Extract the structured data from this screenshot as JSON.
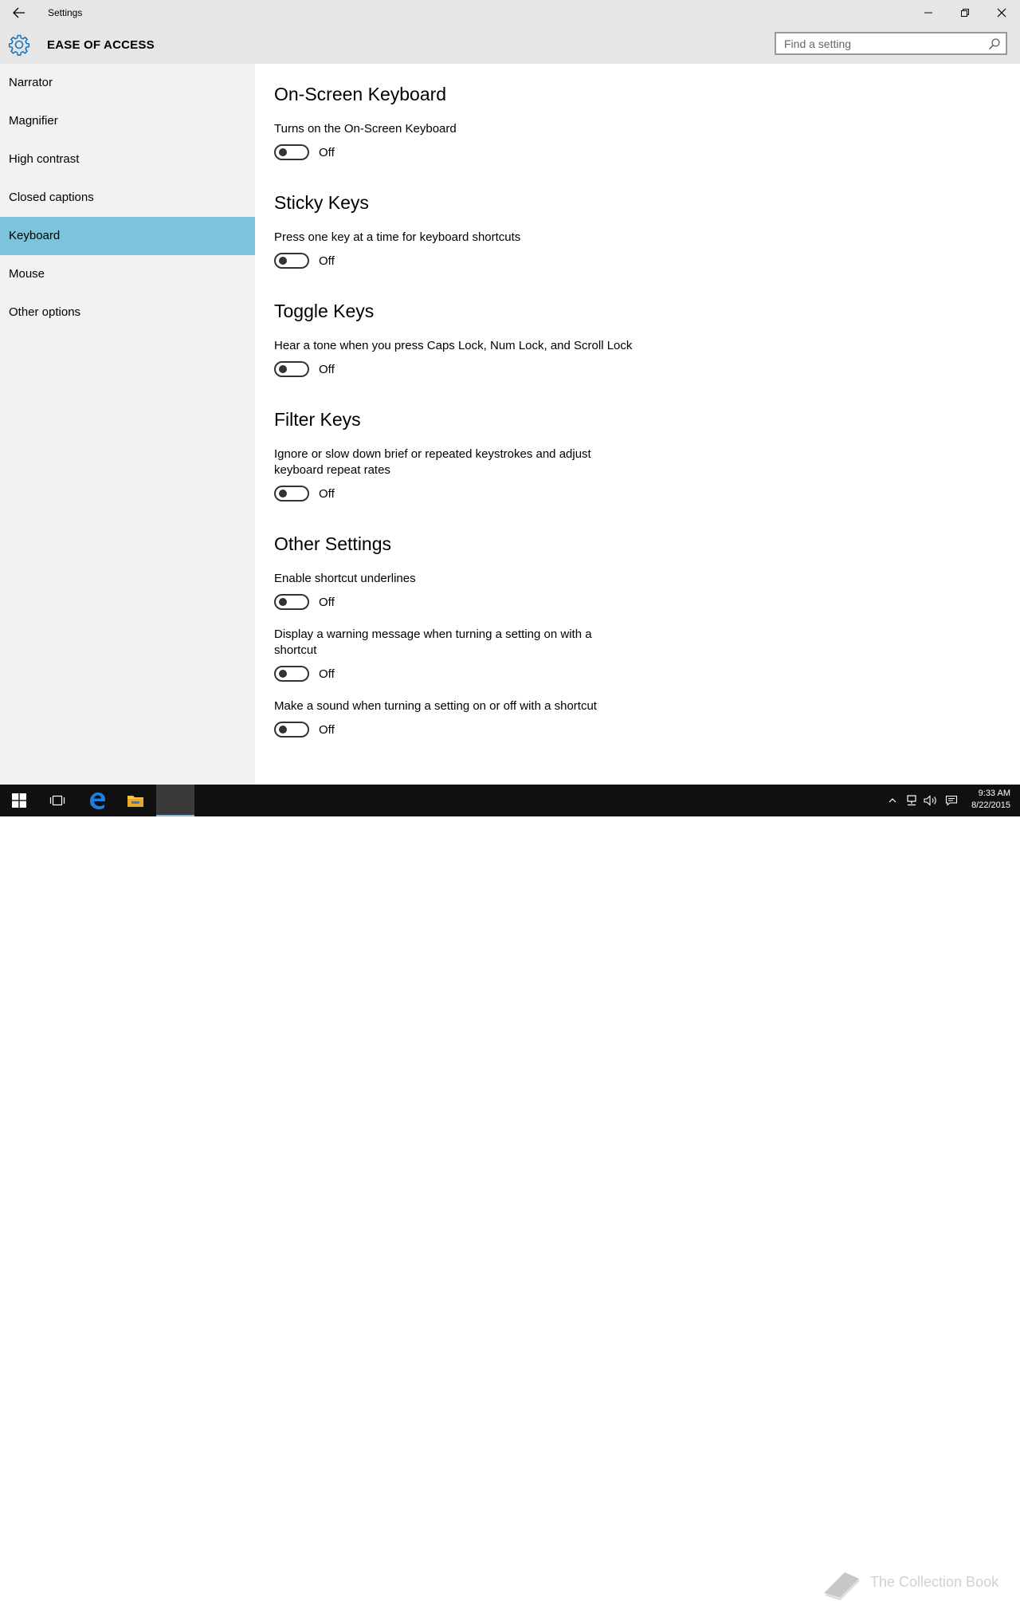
{
  "window": {
    "title": "Settings"
  },
  "header": {
    "section_title": "EASE OF ACCESS",
    "search_placeholder": "Find a setting"
  },
  "sidebar": {
    "items": [
      {
        "label": "Narrator"
      },
      {
        "label": "Magnifier"
      },
      {
        "label": "High contrast"
      },
      {
        "label": "Closed captions"
      },
      {
        "label": "Keyboard",
        "selected": true
      },
      {
        "label": "Mouse"
      },
      {
        "label": "Other options"
      }
    ]
  },
  "groups": [
    {
      "title": "On-Screen Keyboard",
      "settings": [
        {
          "description": "Turns on the On-Screen Keyboard",
          "state": "Off"
        }
      ]
    },
    {
      "title": "Sticky Keys",
      "settings": [
        {
          "description": "Press one key at a time for keyboard shortcuts",
          "state": "Off"
        }
      ]
    },
    {
      "title": "Toggle Keys",
      "settings": [
        {
          "description": "Hear a tone when you press Caps Lock, Num Lock, and Scroll Lock",
          "state": "Off"
        }
      ]
    },
    {
      "title": "Filter Keys",
      "settings": [
        {
          "description": "Ignore or slow down brief or repeated keystrokes and adjust keyboard repeat rates",
          "state": "Off"
        }
      ]
    },
    {
      "title": "Other Settings",
      "settings": [
        {
          "description": "Enable shortcut underlines",
          "state": "Off"
        },
        {
          "description": "Display a warning message when turning a setting on with a shortcut",
          "state": "Off"
        },
        {
          "description": "Make a sound when turning a setting on or off with a shortcut",
          "state": "Off"
        }
      ]
    }
  ],
  "taskbar": {
    "time": "9:33 AM",
    "date": "8/22/2015"
  },
  "watermark": {
    "text": "The Collection Book"
  },
  "colors": {
    "accent": "#7cc3dc",
    "gear": "#1e73be",
    "titlebar": "#e6e6e6",
    "sidebar": "#f2f2f2",
    "taskbar": "#101010"
  }
}
